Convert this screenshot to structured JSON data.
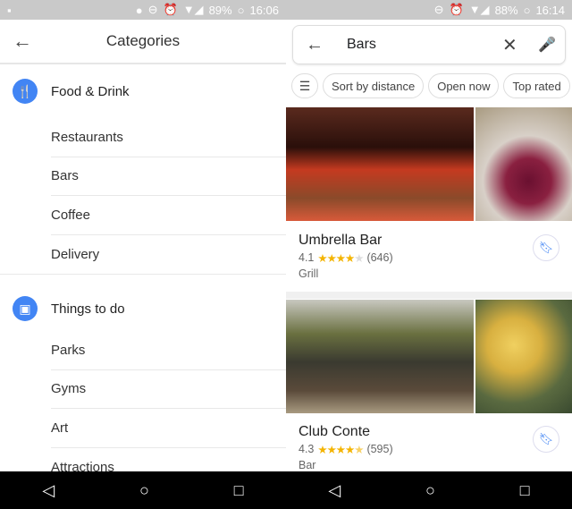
{
  "left": {
    "status": {
      "battery": "89%",
      "time": "16:06"
    },
    "header": {
      "title": "Categories"
    },
    "sections": [
      {
        "title": "Food & Drink",
        "icon": "fork-knife-icon",
        "items": [
          "Restaurants",
          "Bars",
          "Coffee",
          "Delivery"
        ]
      },
      {
        "title": "Things to do",
        "icon": "ticket-icon",
        "items": [
          "Parks",
          "Gyms",
          "Art",
          "Attractions"
        ]
      }
    ]
  },
  "right": {
    "status": {
      "battery": "88%",
      "time": "16:14"
    },
    "search": {
      "query": "Bars"
    },
    "chips": [
      "Sort by distance",
      "Open now",
      "Top rated"
    ],
    "results": [
      {
        "name": "Umbrella Bar",
        "rating": "4.1",
        "stars": 4.1,
        "reviews": "(646)",
        "category": "Grill"
      },
      {
        "name": "Club Conte",
        "rating": "4.3",
        "stars": 4.3,
        "reviews": "(595)",
        "category": "Bar"
      }
    ]
  },
  "colors": {
    "accent": "#4285f4",
    "star": "#f4b400"
  }
}
